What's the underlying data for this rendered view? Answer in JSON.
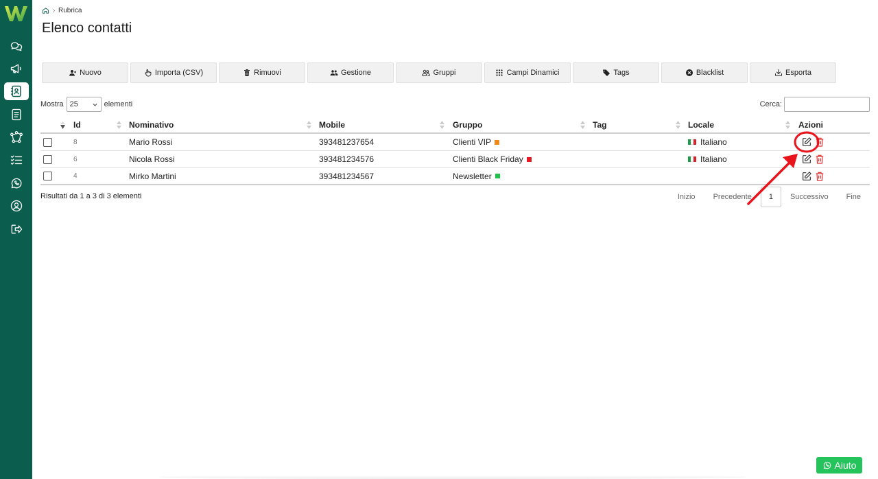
{
  "colors": {
    "sidebar": "#0b5e4d",
    "help": "#25c35b",
    "annotation": "#e8131b",
    "vip": "#f08a1c",
    "black_friday": "#e31b23",
    "newsletter": "#21c04a",
    "delete": "#e03030"
  },
  "sidebar": {
    "items": [
      {
        "name": "chat-icon",
        "active": false
      },
      {
        "name": "megaphone-icon",
        "active": false
      },
      {
        "name": "contacts-icon",
        "active": true
      },
      {
        "name": "document-icon",
        "active": false
      },
      {
        "name": "flow-icon",
        "active": false
      },
      {
        "name": "checklist-icon",
        "active": false
      },
      {
        "name": "whatsapp-icon",
        "active": false
      },
      {
        "name": "user-icon",
        "active": false
      },
      {
        "name": "logout-icon",
        "active": false
      }
    ]
  },
  "breadcrumb": {
    "current": "Rubrica"
  },
  "page": {
    "title": "Elenco contatti"
  },
  "toolbar": {
    "buttons": [
      {
        "label": "Nuovo",
        "icon": "user-plus-icon"
      },
      {
        "label": "Importa (CSV)",
        "icon": "hand-pointer-icon"
      },
      {
        "label": "Rimuovi",
        "icon": "trash-icon"
      },
      {
        "label": "Gestione",
        "icon": "users-icon"
      },
      {
        "label": "Gruppi",
        "icon": "users-outline-icon"
      },
      {
        "label": "Campi Dinamici",
        "icon": "grid-icon"
      },
      {
        "label": "Tags",
        "icon": "tag-icon"
      },
      {
        "label": "Blacklist",
        "icon": "x-circle-icon"
      },
      {
        "label": "Esporta",
        "icon": "download-icon"
      }
    ]
  },
  "length": {
    "prefix": "Mostra",
    "value": "25",
    "suffix": "elementi"
  },
  "search": {
    "label": "Cerca:",
    "value": ""
  },
  "table": {
    "headers": {
      "id": "Id",
      "name": "Nominativo",
      "mobile": "Mobile",
      "group": "Gruppo",
      "tag": "Tag",
      "locale": "Locale",
      "actions": "Azioni"
    },
    "rows": [
      {
        "id": "8",
        "name": "Mario Rossi",
        "mobile": "393481237654",
        "group": "Clienti VIP",
        "group_color": "#f08a1c",
        "tag": "",
        "locale": "Italiano"
      },
      {
        "id": "6",
        "name": "Nicola Rossi",
        "mobile": "393481234576",
        "group": "Clienti Black Friday",
        "group_color": "#e31b23",
        "tag": "",
        "locale": "Italiano"
      },
      {
        "id": "4",
        "name": "Mirko Martini",
        "mobile": "393481234567",
        "group": "Newsletter",
        "group_color": "#21c04a",
        "tag": "",
        "locale": ""
      }
    ]
  },
  "info": "Risultati da 1 a 3 di 3 elementi",
  "pagination": {
    "first": "Inizio",
    "prev": "Precedente",
    "current": "1",
    "next": "Successivo",
    "last": "Fine"
  },
  "help": {
    "label": "Aiuto"
  }
}
